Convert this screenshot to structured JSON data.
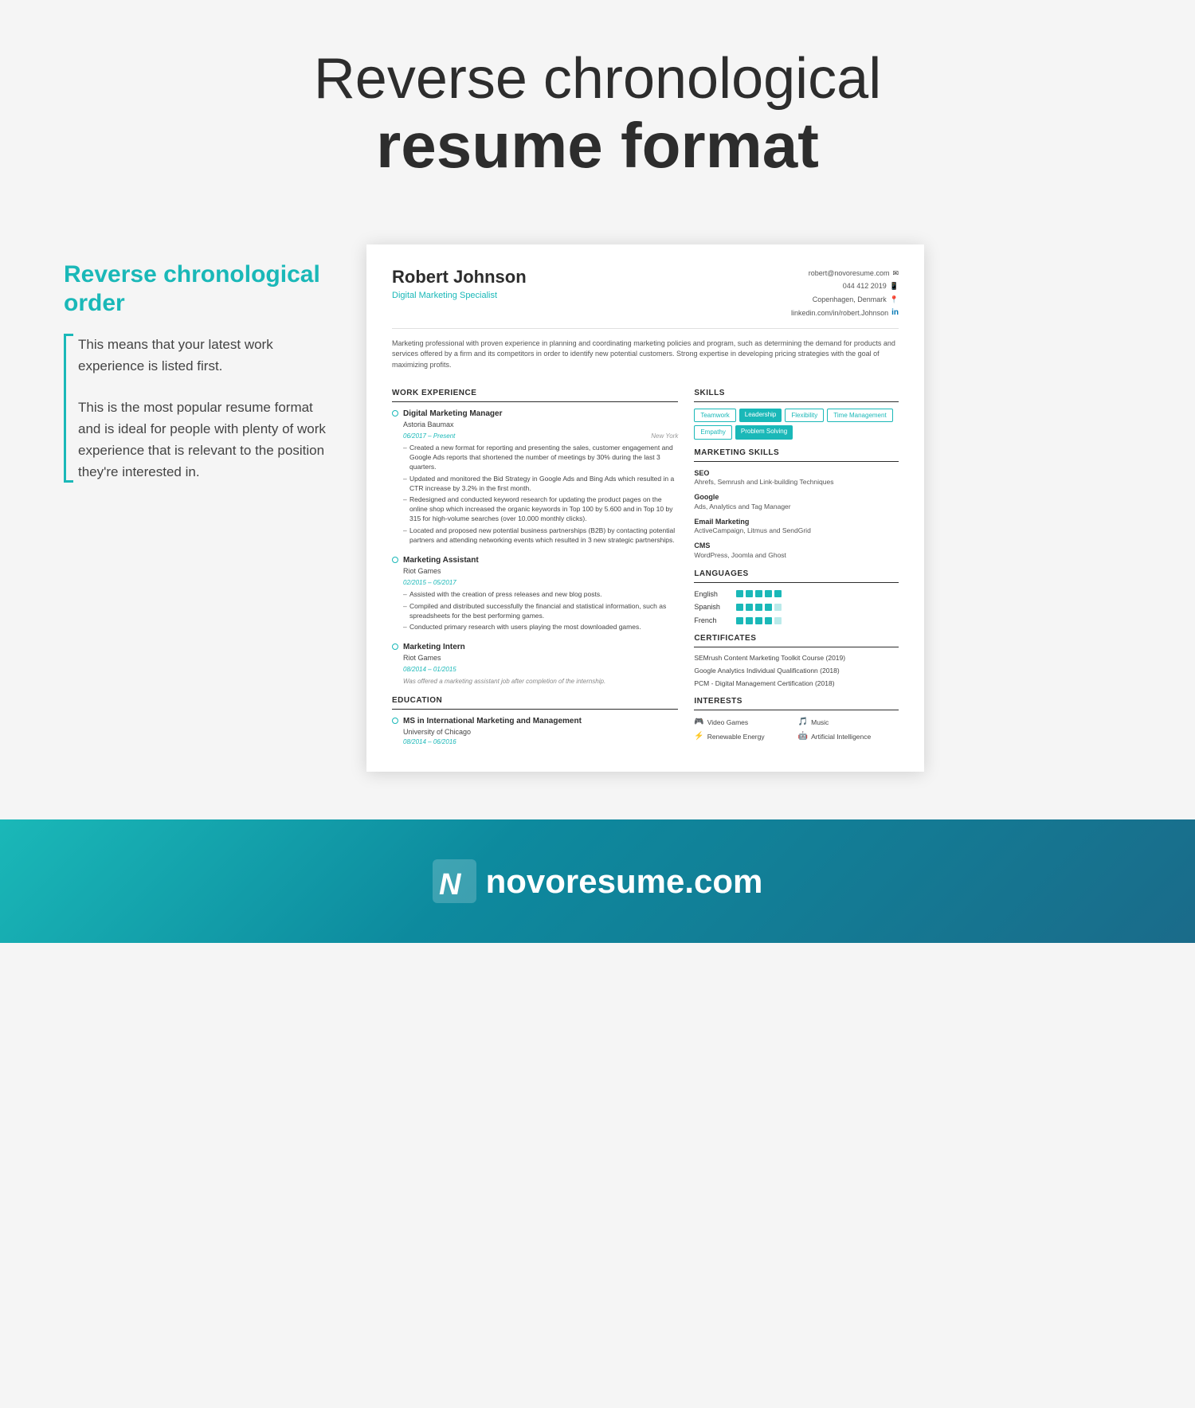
{
  "header": {
    "title_light": "Reverse chronological",
    "title_bold": "resume format"
  },
  "left_panel": {
    "title": "Reverse chronological order",
    "paragraph1": "This means that your latest work experience is listed first.",
    "paragraph2": "This is the most popular resume format and is ideal for people with plenty of work experience that is relevant to the position they're interested in."
  },
  "resume": {
    "name": "Robert Johnson",
    "title": "Digital Marketing Specialist",
    "contact": {
      "email": "robert@novoresume.com",
      "phone": "044 412 2019",
      "location": "Copenhagen, Denmark",
      "linkedin": "linkedin.com/in/robert.Johnson"
    },
    "summary": "Marketing professional with proven experience in planning and coordinating marketing policies and program, such as determining the demand for products and services offered by a firm and its competitors in order to identify new potential customers. Strong expertise in developing pricing strategies with the goal of maximizing profits.",
    "work_experience": {
      "section_label": "WORK EXPERIENCE",
      "jobs": [
        {
          "title": "Digital Marketing Manager",
          "company": "Astoria Baumax",
          "dates": "06/2017 – Present",
          "location": "New York",
          "is_current": true,
          "bullets": [
            "Created a new format for reporting and presenting the sales, customer engagement and Google Ads reports that shortened the number of meetings by 30% during the last 3 quarters.",
            "Updated and monitored the Bid Strategy in Google Ads and Bing Ads which resulted in a CTR increase by 3.2% in the first month.",
            "Redesigned and conducted keyword research for updating the product pages on the online shop which increased the organic keywords in Top 100 by 5.600 and in Top 10 by 315 for high-volume searches (over 10.000 monthly clicks).",
            "Located and proposed new potential business partnerships (B2B) by contacting potential partners and attending networking events which resulted in 3 new strategic partnerships."
          ]
        },
        {
          "title": "Marketing Assistant",
          "company": "Riot Games",
          "dates": "02/2015 – 05/2017",
          "location": "",
          "is_current": false,
          "bullets": [
            "Assisted with the creation of press releases and new blog posts.",
            "Compiled and distributed successfully the financial and statistical information, such as spreadsheets for the best performing games.",
            "Conducted primary research with users playing the most downloaded games."
          ]
        },
        {
          "title": "Marketing Intern",
          "company": "Riot Games",
          "dates": "08/2014 – 01/2015",
          "location": "",
          "is_current": false,
          "bullets": [],
          "note": "Was offered a marketing assistant job after completion of the internship."
        }
      ]
    },
    "education": {
      "section_label": "EDUCATION",
      "entries": [
        {
          "degree": "MS in International Marketing and Management",
          "school": "University of Chicago",
          "dates": "08/2014 – 06/2016"
        }
      ]
    },
    "skills": {
      "section_label": "SKILLS",
      "tags": [
        "Teamwork",
        "Leadership",
        "Flexibility",
        "Time Management",
        "Empathy",
        "Problem Solving"
      ]
    },
    "marketing_skills": {
      "section_label": "MARKETING SKILLS",
      "items": [
        {
          "name": "SEO",
          "desc": "Ahrefs, Semrush and Link-building Techniques"
        },
        {
          "name": "Google",
          "desc": "Ads, Analytics and Tag Manager"
        },
        {
          "name": "Email Marketing",
          "desc": "ActiveCampaign, Litmus and SendGrid"
        },
        {
          "name": "CMS",
          "desc": "WordPress, Joomla and Ghost"
        }
      ]
    },
    "languages": {
      "section_label": "LANGUAGES",
      "items": [
        {
          "name": "English",
          "level": 5
        },
        {
          "name": "Spanish",
          "level": 4
        },
        {
          "name": "French",
          "level": 4
        }
      ]
    },
    "certificates": {
      "section_label": "CERTIFICATES",
      "items": [
        "SEMrush Content Marketing Toolkit Course (2019)",
        "Google Analytics Individual Qualificationn (2018)",
        "PCM - Digital Management Certification (2018)"
      ]
    },
    "interests": {
      "section_label": "INTERESTS",
      "items": [
        {
          "icon": "🎮",
          "label": "Video Games"
        },
        {
          "icon": "🎵",
          "label": "Music"
        },
        {
          "icon": "⚡",
          "label": "Renewable Energy"
        },
        {
          "icon": "🤖",
          "label": "Artificial Intelligence"
        }
      ]
    }
  },
  "footer": {
    "brand": "novoresume.com"
  }
}
